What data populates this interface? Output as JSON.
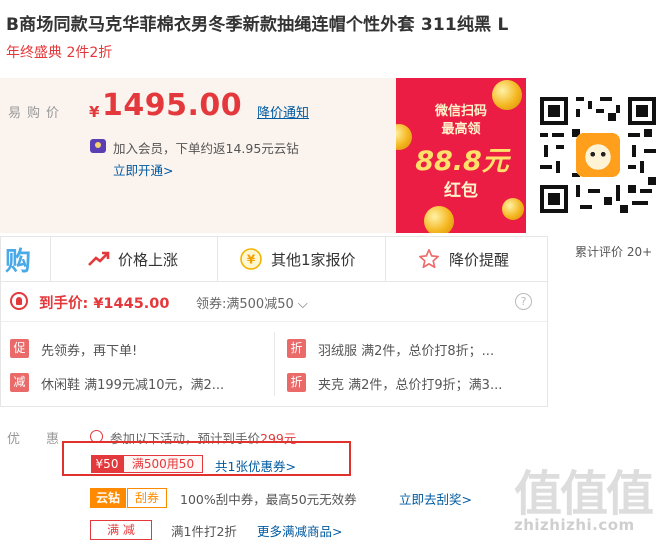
{
  "product": {
    "title": "B商场同款马克华菲棉衣男冬季新款抽绳连帽个性外套 311纯黑 L",
    "subtitle": "年终盛典 2件2折"
  },
  "price": {
    "label": "易购价",
    "currency": "¥",
    "value": "1495.00",
    "notify_link": "降价通知",
    "member_text": "加入会员，下单约返14.95元云钻",
    "member_link": "立即开通>"
  },
  "promo_banner": {
    "line1": "微信扫码",
    "line2": "最高领",
    "amount": "88.8元",
    "line4": "红包",
    "coin_color": "#f4b61f",
    "bg_color": "#ec1d45"
  },
  "review": {
    "text": "累计评价 20+"
  },
  "tabs": [
    {
      "icon": "trend-up-icon",
      "label": "价格上涨"
    },
    {
      "icon": "yen-coin-icon",
      "label": "其他1家报价"
    },
    {
      "icon": "star-icon",
      "label": "降价提醒"
    }
  ],
  "final_price": {
    "label": "到手价: ¥1445.00",
    "coupon_text": "领券:满500减50 ⌵",
    "help": "?"
  },
  "deals": [
    {
      "tag": "促",
      "text": "先领券，再下单!"
    },
    {
      "tag": "折",
      "text": "羽绒服 满2件，总价打8折；..."
    },
    {
      "tag": "减",
      "text": "休闲鞋 满199元减10元，满2..."
    },
    {
      "tag": "折",
      "text": "夹克 满2件，总价打9折；满3..."
    }
  ],
  "offers": {
    "label": "优惠",
    "activity_prefix": "参加以下活动，预计到手价",
    "activity_price": "299元",
    "coupon_amount": "¥50",
    "coupon_rule": "满500用50",
    "coupon_count": "共1张优惠券>",
    "jd_tag": "云钻",
    "scratch_tag": "刮券",
    "jd_text": "100%刮中券，最高50元无效券",
    "jd_link": "立即去刮奖>",
    "full_tag": "满 减",
    "full_text": "满1件打2折",
    "full_link": "更多满减商品>"
  },
  "watermark": {
    "logo": "值值值",
    "domain": "zhizhizhi.com"
  },
  "colors": {
    "accent_red": "#e4393c",
    "link_blue": "#005aa0",
    "highlight_border": "#e0312d",
    "orange": "#ff8a00"
  }
}
